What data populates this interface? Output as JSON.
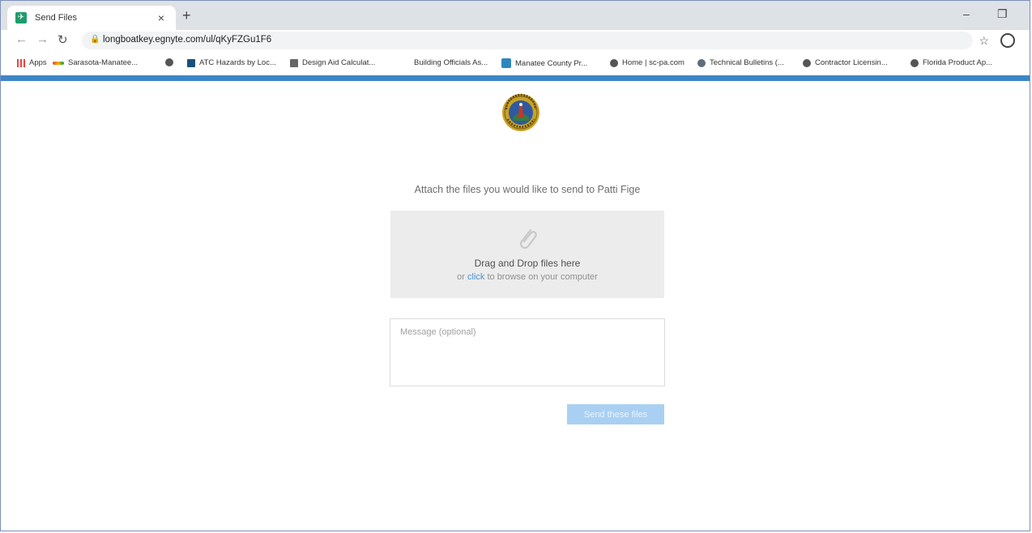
{
  "browser": {
    "tab_title": "Send Files",
    "tab_close": "×",
    "new_tab": "+",
    "url": "longboatkey.egnyte.com/ul/qKyFZGu1F6",
    "bookmarks": [
      {
        "label": "Apps",
        "icon": "apps-grid-icon",
        "color": "#e8453c"
      },
      {
        "label": "Sarasota-Manatee...",
        "icon": "dots-icon",
        "color": "#f4b400"
      },
      {
        "label": "",
        "icon": "globe-icon",
        "color": "#555555"
      },
      {
        "label": "ATC Hazards by Loc...",
        "icon": "atc-icon",
        "color": "#1a5276"
      },
      {
        "label": "Design Aid Calculat...",
        "icon": "calculator-icon",
        "color": "#555555"
      },
      {
        "label": "Building Officials As...",
        "icon": "",
        "color": "#ffffff"
      },
      {
        "label": "Manatee County Pr...",
        "icon": "county-icon",
        "color": "#2e86c1"
      },
      {
        "label": "Home | sc-pa.com",
        "icon": "globe-icon",
        "color": "#555555"
      },
      {
        "label": "Technical Bulletins (...",
        "icon": "bulletin-icon",
        "color": "#5d6d7e"
      },
      {
        "label": "Contractor Licensin...",
        "icon": "globe-icon",
        "color": "#555555"
      },
      {
        "label": "Florida Product Ap...",
        "icon": "globe-icon",
        "color": "#555555"
      }
    ]
  },
  "page": {
    "heading": "Attach the files you would like to send to Patti Fige",
    "dropzone": {
      "title": "Drag and Drop files here",
      "sub_prefix": "or ",
      "sub_link": "click",
      "sub_suffix": " to browse on your computer"
    },
    "message_placeholder": "Message (optional)",
    "send_button": "Send these files"
  },
  "colors": {
    "accent": "#3d86c6",
    "button": "#a9d0f2",
    "link": "#4a90d9"
  }
}
